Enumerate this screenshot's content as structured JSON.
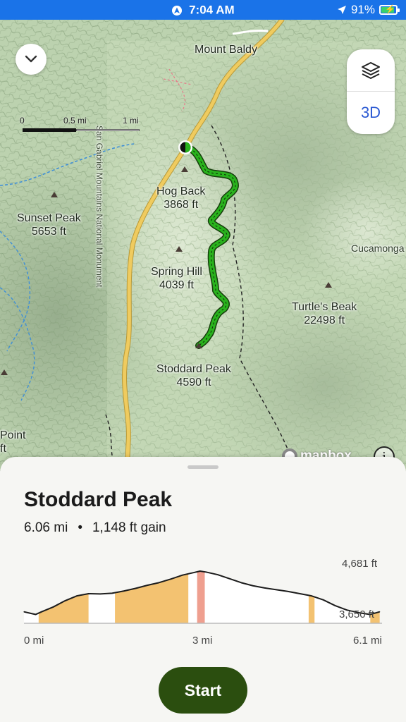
{
  "status_bar": {
    "time": "7:04 AM",
    "battery": "91%",
    "battery_level": 0.91,
    "icons": [
      "location-arrow-icon",
      "battery-charging-icon"
    ]
  },
  "map": {
    "places": [
      {
        "name": "Mount Baldy",
        "elevation": ""
      },
      {
        "name": "Hog Back",
        "elevation": "3868 ft"
      },
      {
        "name": "Sunset Peak",
        "elevation": "5653 ft"
      },
      {
        "name": "Spring Hill",
        "elevation": "4039 ft"
      },
      {
        "name": "Turtle's Beak",
        "elevation": "22498 ft"
      },
      {
        "name": "Stoddard Peak",
        "elevation": "4590 ft"
      },
      {
        "name": "Cucamonga",
        "elevation": ""
      },
      {
        "name": "Point",
        "elevation": "ft"
      },
      {
        "name": "San Gabriel Mountains National Monument",
        "elevation": ""
      }
    ],
    "scale": {
      "zero": "0",
      "half": "0.5 mi",
      "one": "1 mi"
    },
    "buttons": {
      "three_d_label": "3D"
    },
    "attribution": "mapbox",
    "info_glyph": "i",
    "colors": {
      "trail": "#29b31d",
      "road": "#efcb5f",
      "water": "#3f8fd6"
    }
  },
  "sheet": {
    "title": "Stoddard Peak",
    "distance": "6.06 mi",
    "separator": "•",
    "gain": "1,148 ft gain",
    "start_label": "Start"
  },
  "chart_data": {
    "type": "area",
    "xlabel": "",
    "ylabel": "",
    "x_ticks": [
      "0 mi",
      "3 mi",
      "6.1 mi"
    ],
    "y_ticks": [
      "4,681 ft",
      "3,650 ft"
    ],
    "xlim": [
      0,
      6.1
    ],
    "ylim": [
      3650,
      4681
    ],
    "series": [
      {
        "x": [
          0,
          0.1,
          0.2,
          0.3,
          0.5,
          0.7,
          0.9,
          1.1,
          1.3,
          1.5,
          1.7,
          1.9,
          2.1,
          2.3,
          2.5,
          2.7,
          2.9,
          3.0,
          3.1,
          3.3,
          3.5,
          3.7,
          3.9,
          4.1,
          4.3,
          4.5,
          4.7,
          4.9,
          5.1,
          5.3,
          5.5,
          5.7,
          5.9,
          6.06
        ],
        "y": [
          3760,
          3730,
          3700,
          3760,
          3870,
          4010,
          4120,
          4170,
          4165,
          4180,
          4230,
          4290,
          4360,
          4420,
          4500,
          4590,
          4650,
          4681,
          4660,
          4600,
          4510,
          4420,
          4350,
          4300,
          4260,
          4220,
          4170,
          4120,
          4030,
          3900,
          3800,
          3740,
          3700,
          3760
        ]
      }
    ],
    "shaded_ranges": [
      {
        "x_start": 0.25,
        "x_end": 1.1,
        "color": "#f3c271"
      },
      {
        "x_start": 1.55,
        "x_end": 2.8,
        "color": "#f3c271"
      },
      {
        "x_start": 2.95,
        "x_end": 3.08,
        "color": "#ef9f8f"
      },
      {
        "x_start": 4.85,
        "x_end": 4.95,
        "color": "#f3c271"
      },
      {
        "x_start": 5.9,
        "x_end": 6.06,
        "color": "#f3c271"
      }
    ]
  }
}
